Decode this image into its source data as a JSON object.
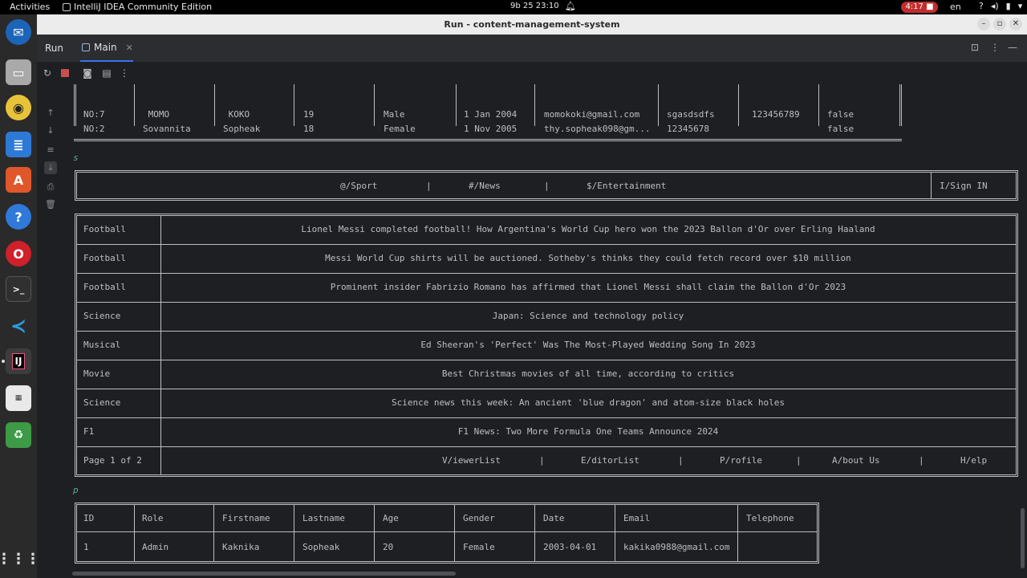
{
  "topbar": {
    "activities": "Activities",
    "app_name": "IntelliJ IDEA Community Edition",
    "clock": "9b 25  23:10",
    "recording": "4:17",
    "lang": "en"
  },
  "window": {
    "title": "Run - content-management-system"
  },
  "toolwindow": {
    "run_label": "Run",
    "tab_label": "Main"
  },
  "console": {
    "top_table_rows": [
      {
        "id": "NO:7",
        "first": " MOMO",
        "last": " KOKO",
        "age": "19",
        "gender": "Male",
        "dob": "1 Jan 2004",
        "email": "momokoki@gmail.com",
        "pass": "sgasdsdfs",
        "phone": "123456789",
        "flag": "false"
      },
      {
        "id": "NO:2",
        "first": "Sovannita",
        "last": "Sopheak",
        "age": "18",
        "gender": "Female",
        "dob": "1 Nov 2005",
        "email": "thy.sopheak098@gm...",
        "pass": "12345678",
        "phone": "",
        "flag": "false"
      }
    ],
    "input_1": "s",
    "nav": {
      "sport": "@/Sport",
      "news": "#/News",
      "entertainment": "$/Entertainment",
      "sep": "|",
      "signin": "I/Sign IN"
    },
    "news": [
      {
        "category": "Football",
        "title": "Lionel Messi completed football! How Argentina's World Cup hero won the 2023 Ballon d'Or over Erling Haaland"
      },
      {
        "category": "Football",
        "title": "Messi World Cup shirts will be auctioned. Sotheby's thinks they could fetch record over $10 million"
      },
      {
        "category": "Football",
        "title": "Prominent insider Fabrizio Romano has affirmed that Lionel Messi shall claim the Ballon d'Or 2023"
      },
      {
        "category": "Science",
        "title": "Japan: Science and technology policy"
      },
      {
        "category": "Musical",
        "title": "Ed Sheeran's 'Perfect' Was The Most-Played Wedding Song In 2023"
      },
      {
        "category": "Movie",
        "title": "Best Christmas movies of all time, according to critics"
      },
      {
        "category": "Science",
        "title": "Science news this week: An ancient 'blue dragon' and atom-size black holes"
      },
      {
        "category": "F1",
        "title": "F1 News: Two More Formula One Teams Announce 2024"
      }
    ],
    "footer": {
      "page": "Page 1 of 2",
      "viewer": "V/iewerList",
      "editor": "E/ditorList",
      "profile": "P/rofile",
      "about": "A/bout Us",
      "help": "H/elp",
      "sep": "|"
    },
    "input_2": "p",
    "profile_table": {
      "headers": [
        "ID",
        "Role",
        "Firstname",
        "Lastname",
        "Age",
        "Gender",
        "Date",
        "Email",
        "Telephone"
      ],
      "row": [
        "1",
        "Admin",
        "Kaknika",
        "Sopheak",
        "20",
        "Female",
        "2003-04-01",
        "kakika0988@gmail.com",
        ""
      ]
    }
  }
}
